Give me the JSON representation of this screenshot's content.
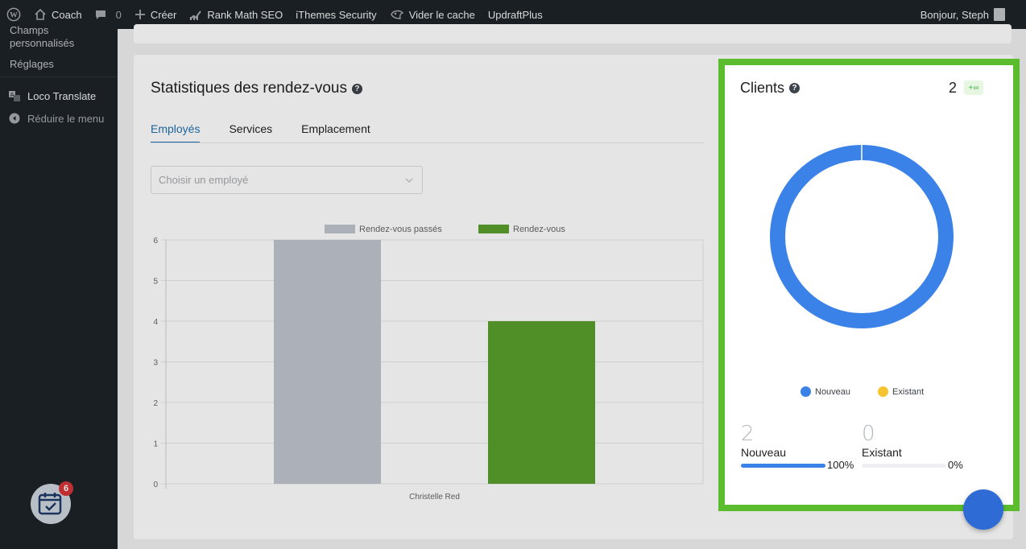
{
  "adminbar": {
    "site_name": "Coach",
    "comments_count": "0",
    "create_label": "Créer",
    "rank_math_label": "Rank Math SEO",
    "ithemes_label": "iThemes Security",
    "cache_label": "Vider le cache",
    "updraft_label": "UpdraftPlus",
    "greeting": "Bonjour, Steph"
  },
  "sidebar": {
    "sub_items": [
      "Champs",
      "personnalisés",
      "Réglages"
    ],
    "loco_label": "Loco Translate",
    "collapse_label": "Réduire le menu",
    "app_badge": "6"
  },
  "stats": {
    "title": "Statistiques des rendez-vous",
    "tabs": [
      "Employés",
      "Services",
      "Emplacement"
    ],
    "active_tab": "Employés",
    "employee_placeholder": "Choisir un employé"
  },
  "chart_data": {
    "type": "bar",
    "categories": [
      "Christelle Red"
    ],
    "series": [
      {
        "name": "Rendez-vous passés",
        "values": [
          6
        ],
        "color": "#bfc5cf"
      },
      {
        "name": "Rendez-vous",
        "values": [
          4
        ],
        "color": "#5aa02c"
      }
    ],
    "y_ticks": [
      0,
      1,
      2,
      3,
      4,
      5,
      6
    ],
    "ylim": [
      0,
      6
    ],
    "grid": true,
    "legend": "top"
  },
  "clients": {
    "title": "Clients",
    "total": "2",
    "delta": "+∞",
    "legend": [
      {
        "label": "Nouveau",
        "color": "#3b82e8"
      },
      {
        "label": "Existant",
        "color": "#f5c431"
      }
    ],
    "donut": {
      "nouveau": 2,
      "existant": 0
    },
    "stats": [
      {
        "value": "2",
        "label": "Nouveau",
        "percent": "100%",
        "fraction": 1.0
      },
      {
        "value": "0",
        "label": "Existant",
        "percent": "0%",
        "fraction": 0.0
      }
    ]
  },
  "colors": {
    "accent": "#2271b1",
    "highlight": "#5bbd2d"
  }
}
